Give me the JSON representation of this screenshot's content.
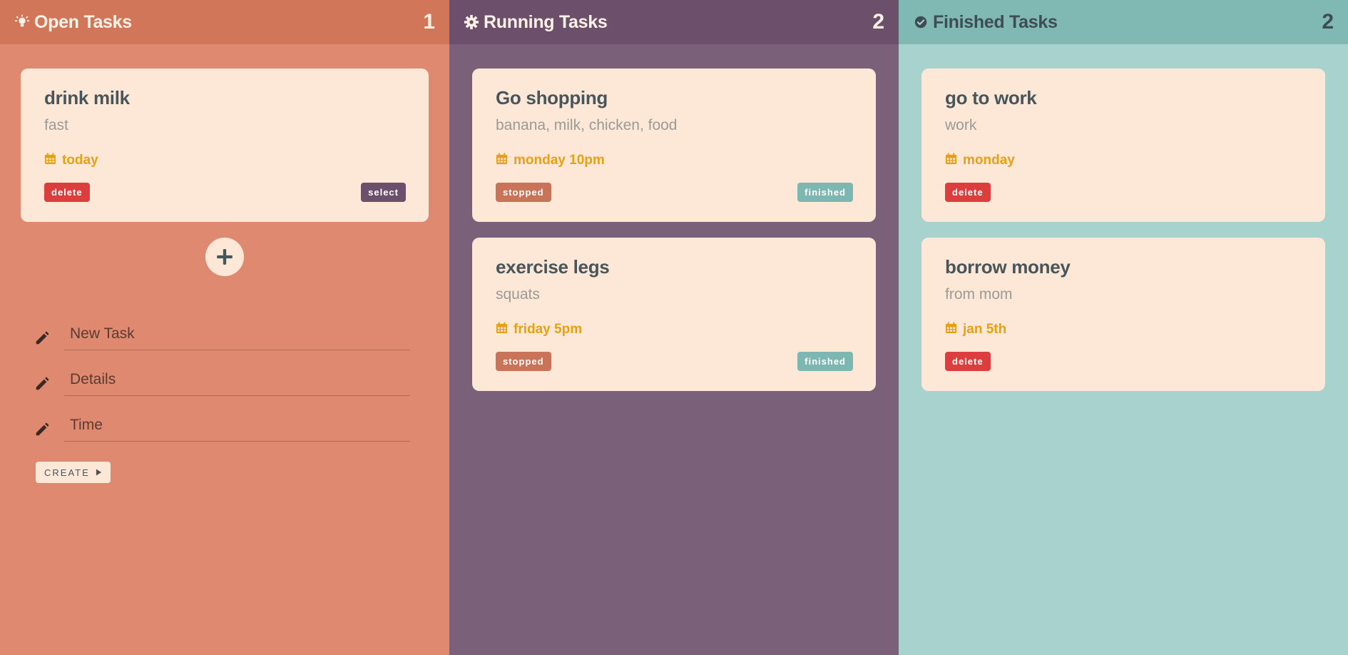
{
  "columns": [
    {
      "title": "Open Tasks",
      "count": "1",
      "icon": "lightbulb-icon",
      "tasks": [
        {
          "title": "drink milk",
          "details": "fast",
          "time": "today",
          "left_action": "delete",
          "right_action": "select"
        }
      ]
    },
    {
      "title": "Running Tasks",
      "count": "2",
      "icon": "gear-icon",
      "tasks": [
        {
          "title": "Go shopping",
          "details": "banana, milk, chicken, food",
          "time": "monday 10pm",
          "left_action": "stopped",
          "right_action": "finished"
        },
        {
          "title": "exercise legs",
          "details": "squats",
          "time": "friday 5pm",
          "left_action": "stopped",
          "right_action": "finished"
        }
      ]
    },
    {
      "title": "Finished Tasks",
      "count": "2",
      "icon": "check-circle-icon",
      "tasks": [
        {
          "title": "go to work",
          "details": "work",
          "time": "monday",
          "left_action": "delete"
        },
        {
          "title": "borrow money",
          "details": "from mom",
          "time": "jan 5th",
          "left_action": "delete"
        }
      ]
    }
  ],
  "form": {
    "task_placeholder": "New Task",
    "details_placeholder": "Details",
    "time_placeholder": "Time",
    "create_label": "CREATE"
  },
  "colors": {
    "open": "#df8a70",
    "running": "#7a6078",
    "finished": "#a8d2ce",
    "card": "#fde8d8",
    "delete": "#dc3d3d",
    "time_accent": "#e6a012"
  }
}
